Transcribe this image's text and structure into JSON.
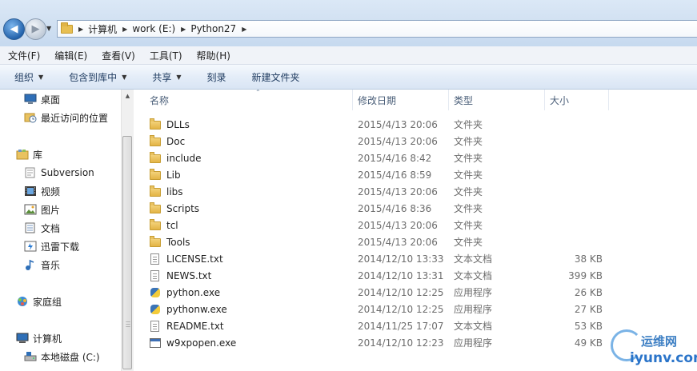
{
  "address": {
    "breadcrumbs": [
      "计算机",
      "work (E:)",
      "Python27"
    ]
  },
  "menu": [
    "文件(F)",
    "编辑(E)",
    "查看(V)",
    "工具(T)",
    "帮助(H)"
  ],
  "commands": [
    {
      "label": "组织",
      "dropdown": true
    },
    {
      "label": "包含到库中",
      "dropdown": true
    },
    {
      "label": "共享",
      "dropdown": true
    },
    {
      "label": "刻录",
      "dropdown": false
    },
    {
      "label": "新建文件夹",
      "dropdown": false
    }
  ],
  "nav": {
    "items": [
      {
        "label": "桌面",
        "icon": "desktop-icon"
      },
      {
        "label": "最近访问的位置",
        "icon": "recent-icon"
      },
      {
        "label": "库",
        "icon": "library-icon"
      },
      {
        "label": "Subversion",
        "icon": "subversion-icon"
      },
      {
        "label": "视频",
        "icon": "video-icon"
      },
      {
        "label": "图片",
        "icon": "picture-icon"
      },
      {
        "label": "文档",
        "icon": "document-icon"
      },
      {
        "label": "迅雷下载",
        "icon": "thunder-download-icon"
      },
      {
        "label": "音乐",
        "icon": "music-icon"
      },
      {
        "label": "家庭组",
        "icon": "homegroup-icon"
      },
      {
        "label": "计算机",
        "icon": "computer-icon"
      },
      {
        "label": "本地磁盘 (C:)",
        "icon": "disk-icon"
      }
    ]
  },
  "columns": {
    "name": "名称",
    "date": "修改日期",
    "type": "类型",
    "size": "大小"
  },
  "files": [
    {
      "name": "DLLs",
      "date": "2015/4/13 20:06",
      "type": "文件夹",
      "size": "",
      "icon": "folder-icon"
    },
    {
      "name": "Doc",
      "date": "2015/4/13 20:06",
      "type": "文件夹",
      "size": "",
      "icon": "folder-icon"
    },
    {
      "name": "include",
      "date": "2015/4/16 8:42",
      "type": "文件夹",
      "size": "",
      "icon": "folder-icon"
    },
    {
      "name": "Lib",
      "date": "2015/4/16 8:59",
      "type": "文件夹",
      "size": "",
      "icon": "folder-icon"
    },
    {
      "name": "libs",
      "date": "2015/4/13 20:06",
      "type": "文件夹",
      "size": "",
      "icon": "folder-icon"
    },
    {
      "name": "Scripts",
      "date": "2015/4/16 8:36",
      "type": "文件夹",
      "size": "",
      "icon": "folder-icon"
    },
    {
      "name": "tcl",
      "date": "2015/4/13 20:06",
      "type": "文件夹",
      "size": "",
      "icon": "folder-icon"
    },
    {
      "name": "Tools",
      "date": "2015/4/13 20:06",
      "type": "文件夹",
      "size": "",
      "icon": "folder-icon"
    },
    {
      "name": "LICENSE.txt",
      "date": "2014/12/10 13:33",
      "type": "文本文档",
      "size": "38 KB",
      "icon": "text-file-icon"
    },
    {
      "name": "NEWS.txt",
      "date": "2014/12/10 13:31",
      "type": "文本文档",
      "size": "399 KB",
      "icon": "text-file-icon"
    },
    {
      "name": "python.exe",
      "date": "2014/12/10 12:25",
      "type": "应用程序",
      "size": "26 KB",
      "icon": "python-icon"
    },
    {
      "name": "pythonw.exe",
      "date": "2014/12/10 12:25",
      "type": "应用程序",
      "size": "27 KB",
      "icon": "python-icon"
    },
    {
      "name": "README.txt",
      "date": "2014/11/25 17:07",
      "type": "文本文档",
      "size": "53 KB",
      "icon": "text-file-icon"
    },
    {
      "name": "w9xpopen.exe",
      "date": "2014/12/10 12:23",
      "type": "应用程序",
      "size": "49 KB",
      "icon": "exe-icon"
    }
  ],
  "watermark": {
    "title": "运维网",
    "url": "iyunv.com"
  }
}
